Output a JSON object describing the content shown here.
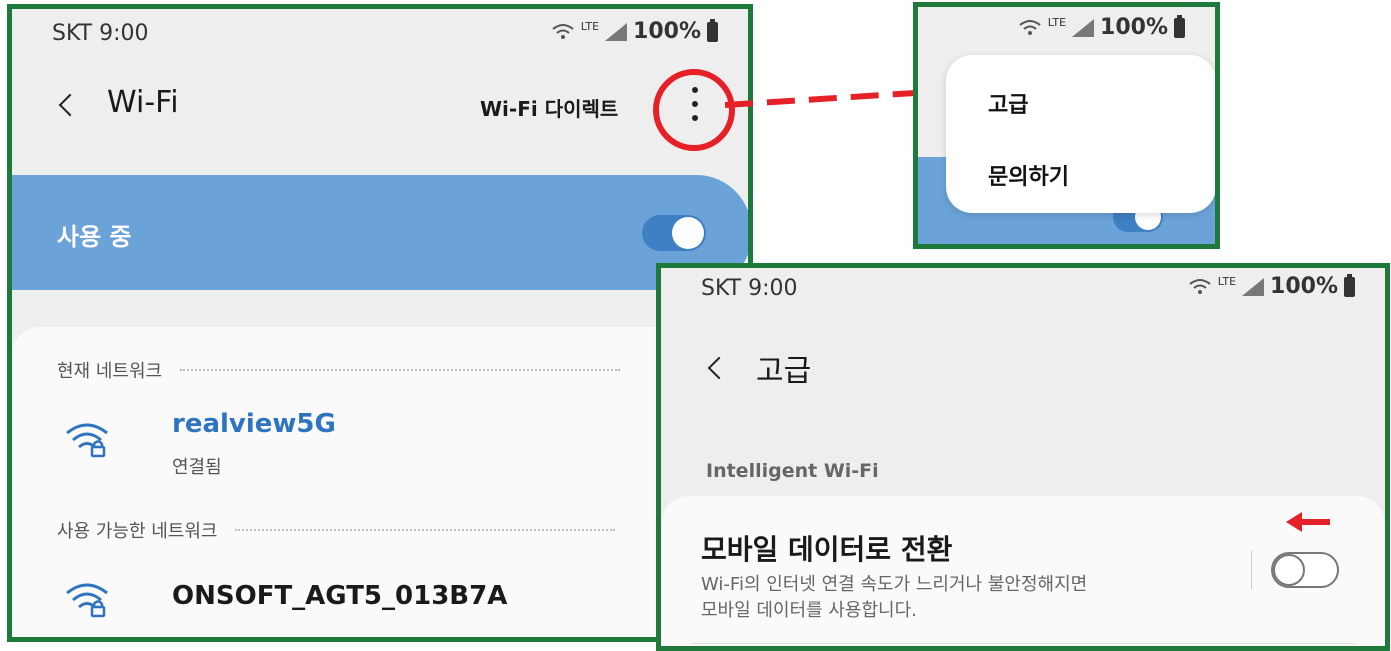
{
  "status_bar": {
    "carrier_time": "SKT 9:00",
    "network": "LTE",
    "battery": "100%"
  },
  "wifi_screen": {
    "title": "Wi-Fi",
    "wifi_direct": "Wi-Fi 다이렉트",
    "enabled_label": "사용 중",
    "current_network_header": "현재 네트워크",
    "current_network": {
      "name": "realview5G",
      "status": "연결됨"
    },
    "available_networks_header": "사용 가능한 네트워크",
    "available_networks": [
      {
        "name": "ONSOFT_AGT5_013B7A"
      }
    ]
  },
  "overflow_menu": {
    "items": [
      {
        "label": "고급"
      },
      {
        "label": "문의하기"
      }
    ]
  },
  "advanced_screen": {
    "title": "고급",
    "section": "Intelligent Wi-Fi",
    "switch_item": {
      "title": "모바일 데이터로 전환",
      "description_line1": "Wi-Fi의 인터넷 연결 속도가 느리거나 불안정해지면",
      "description_line2": "모바일 데이터를 사용합니다.",
      "enabled": false
    }
  },
  "colors": {
    "frame": "#1e7a3a",
    "highlight": "#e52026",
    "accent_blue": "#6ba3d8",
    "link_blue": "#2f74bf"
  }
}
